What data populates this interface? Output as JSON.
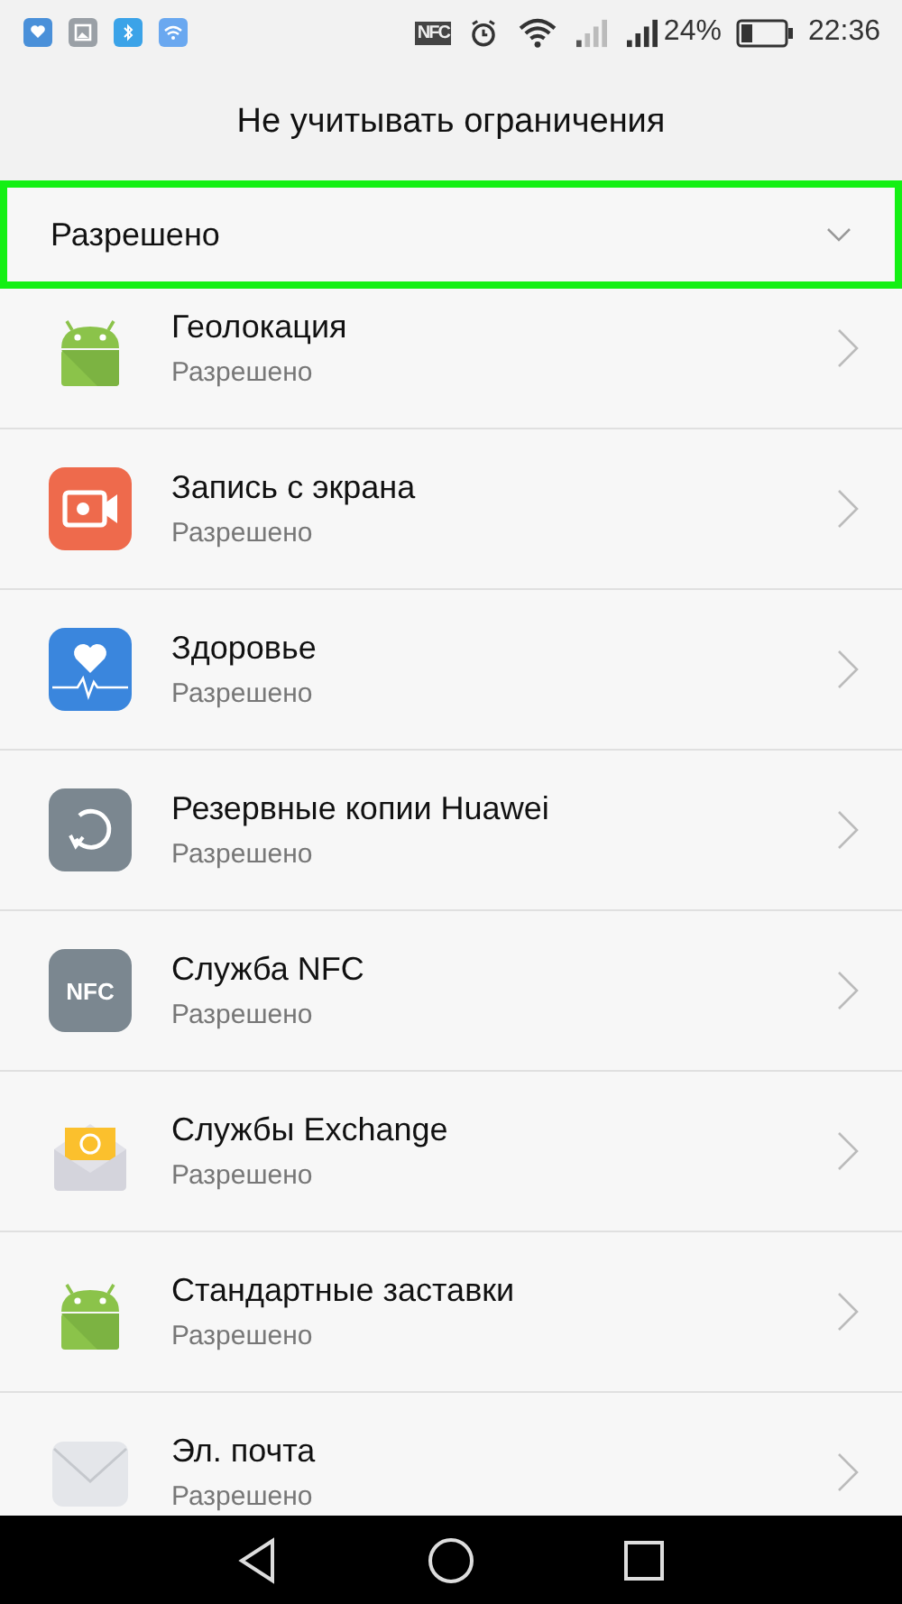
{
  "status_bar": {
    "nfc_label": "NFC",
    "battery": "24%",
    "time": "22:36"
  },
  "title": "Не учитывать ограничения",
  "filter": {
    "value": "Разрешено",
    "highlighted": true
  },
  "apps": [
    {
      "name": "Геолокация",
      "status": "Разрешено",
      "kind": "android"
    },
    {
      "name": "Запись с экрана",
      "status": "Разрешено",
      "kind": "record"
    },
    {
      "name": "Здоровье",
      "status": "Разрешено",
      "kind": "health"
    },
    {
      "name": "Резервные копии Huawei",
      "status": "Разрешено",
      "kind": "backup"
    },
    {
      "name": "Служба NFC",
      "status": "Разрешено",
      "kind": "nfc",
      "icon_label": "NFC"
    },
    {
      "name": "Службы Exchange",
      "status": "Разрешено",
      "kind": "exchange"
    },
    {
      "name": "Стандартные заставки",
      "status": "Разрешено",
      "kind": "android"
    },
    {
      "name": "Эл. почта",
      "status": "Разрешено",
      "kind": "mail"
    }
  ]
}
